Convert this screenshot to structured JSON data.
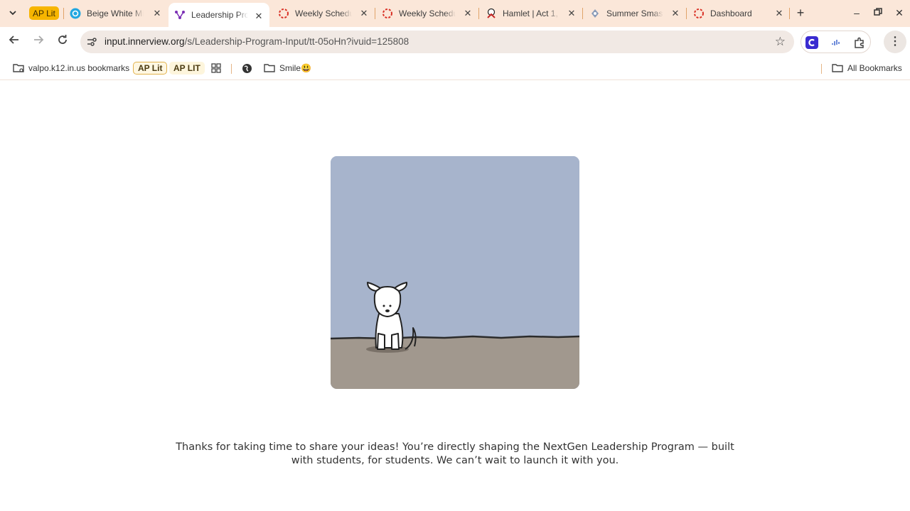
{
  "tabs": {
    "group_label": "AP Lit",
    "items": [
      {
        "title": "Beige White Mi",
        "favicon": "canva-icon"
      },
      {
        "title": "Leadership Pro",
        "favicon": "innerview-icon",
        "active": true
      },
      {
        "title": "Weekly Schedul",
        "favicon": "loading-ring-icon"
      },
      {
        "title": "Weekly Schedul",
        "favicon": "loading-ring-icon"
      },
      {
        "title": "Hamlet | Act 1,",
        "favicon": "hamlet-icon"
      },
      {
        "title": "Summer Smas",
        "favicon": "summer-icon"
      },
      {
        "title": "Dashboard",
        "favicon": "loading-ring-icon"
      }
    ]
  },
  "address_bar": {
    "host": "input.innerview.org",
    "path": "/s/Leadership-Program-Input/tt-05oHn?ivuid=125808"
  },
  "bookmarks": {
    "items": [
      {
        "label": "valpo.k12.in.us bookmarks"
      },
      {
        "label": "AP Lit"
      },
      {
        "label": "AP LIT"
      },
      {
        "label": "Smile😃"
      }
    ],
    "all_label": "All Bookmarks"
  },
  "colors": {
    "tabstrip": "#fbe7d9",
    "group_chip": "#f7b500",
    "sky": "#a7b4cc",
    "ground": "#a1988e"
  },
  "page": {
    "message": "Thanks for taking  time to share your ideas! You’re directly shaping the NextGen Leadership Program — built with students, for students. We can’t wait to launch it with you."
  }
}
